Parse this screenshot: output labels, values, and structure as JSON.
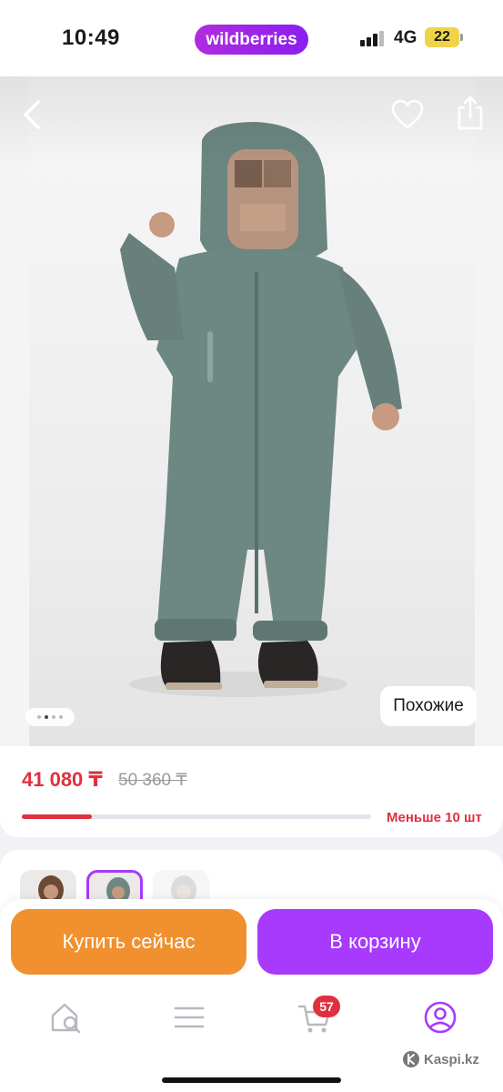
{
  "status_bar": {
    "time": "10:49",
    "brand": "wildberries",
    "network": "4G",
    "battery": "22"
  },
  "gallery": {
    "image_description_icon": "child-winter-overall-photo",
    "dots_total": 4,
    "dots_active_index": 1,
    "similar_label": "Похожие"
  },
  "price": {
    "current": "41 080 ₸",
    "old": "50 360 ₸",
    "stock_label": "Меньше 10 шт",
    "stock_fill_fraction": 0.2
  },
  "actions": {
    "buy_now_label": "Купить сейчас",
    "add_to_cart_label": "В корзину"
  },
  "tab_bar": {
    "cart_badge": "57"
  },
  "watermark": "Kaspi.kz",
  "colors": {
    "brand_purple": "#a73afd",
    "buy_orange": "#f0902e",
    "price_red": "#e0303d"
  }
}
